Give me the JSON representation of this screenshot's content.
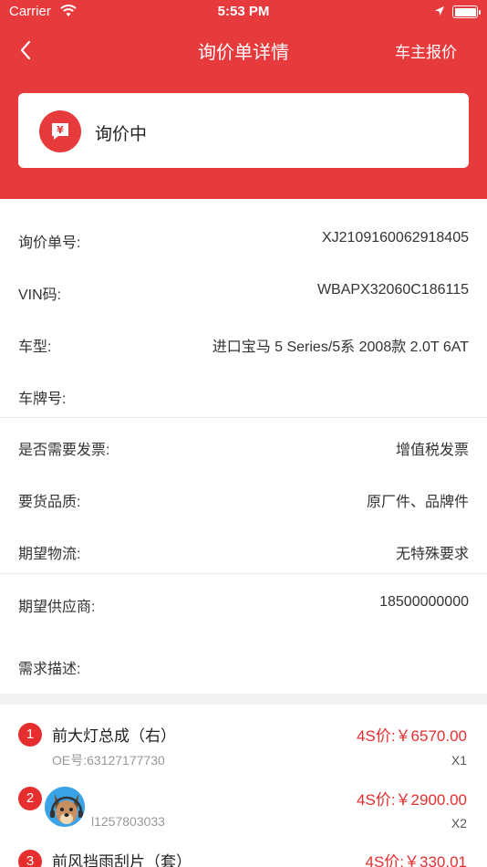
{
  "status_bar": {
    "carrier": "Carrier",
    "time": "5:53 PM"
  },
  "nav": {
    "title": "询价单详情",
    "action": "车主报价"
  },
  "status_card": {
    "text": "询价中",
    "icon_glyph": "¥"
  },
  "info": {
    "inquiry_no": {
      "label": "询价单号:",
      "value": "XJ2109160062918405"
    },
    "vin": {
      "label": "VIN码:",
      "value": "WBAPX32060C186115"
    },
    "model": {
      "label": "车型:",
      "value": "进口宝马 5 Series/5系 2008款 2.0T 6AT"
    },
    "plate": {
      "label": "车牌号:",
      "value": ""
    },
    "invoice": {
      "label": "是否需要发票:",
      "value": "增值税发票"
    },
    "quality": {
      "label": "要货品质:",
      "value": "原厂件、品牌件"
    },
    "logistics": {
      "label": "期望物流:",
      "value": "无特殊要求"
    },
    "supplier": {
      "label": "期望供应商:",
      "value": "18500000000"
    },
    "description": {
      "label": "需求描述:",
      "value": ""
    }
  },
  "parts": [
    {
      "num": "1",
      "name": "前大灯总成（右）",
      "oe": "OE号:63127177730",
      "price": "4S价:￥6570.00",
      "qty": "X1"
    },
    {
      "num": "2",
      "name": "",
      "oe": "l1257803033",
      "price": "4S价:￥2900.00",
      "qty": "X2"
    },
    {
      "num": "3",
      "name": "前风挡雨刮片（套）",
      "oe": "",
      "price": "4S价:￥330.01",
      "qty": ""
    }
  ],
  "colors": {
    "brand_red": "#e63a3d",
    "price_red": "#e62e2e"
  }
}
